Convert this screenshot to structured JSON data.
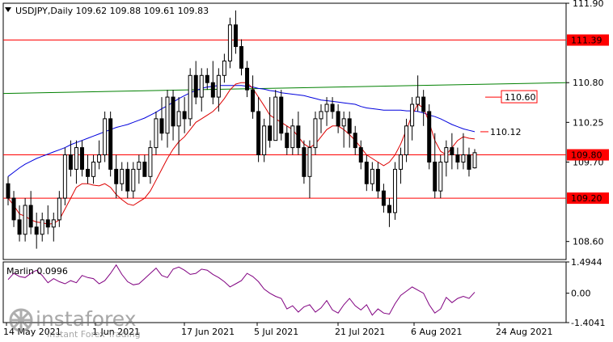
{
  "title": {
    "symbol_info": "USDJPY,Daily  109.62 109.88 109.61 109.83"
  },
  "chart_data": [
    {
      "type": "candlestick",
      "symbol": "USDJPY",
      "timeframe": "Daily",
      "ohlc_header": [
        109.62,
        109.88,
        109.61,
        109.83
      ],
      "ylim": [
        108.35,
        111.9
      ],
      "price_ticks": [
        "111.90",
        "110.80",
        "110.25",
        "109.70",
        "108.60"
      ],
      "x_tick_labels": [
        "14 May 2021",
        "1 Jun 2021",
        "17 Jun 2021",
        "5 Jul 2021",
        "21 Jul 2021",
        "6 Aug 2021",
        "24 Aug 2021"
      ],
      "candles": [
        [
          109.4,
          109.5,
          109.1,
          109.2
        ],
        [
          109.2,
          109.3,
          108.8,
          108.9
        ],
        [
          108.9,
          109.1,
          108.6,
          108.7
        ],
        [
          108.7,
          109.2,
          108.6,
          109.1
        ],
        [
          109.1,
          109.3,
          108.7,
          108.8
        ],
        [
          108.8,
          109.0,
          108.5,
          108.7
        ],
        [
          108.7,
          109.0,
          108.6,
          108.9
        ],
        [
          108.9,
          109.1,
          108.7,
          108.8
        ],
        [
          108.8,
          109.0,
          108.6,
          108.9
        ],
        [
          108.9,
          109.3,
          108.8,
          109.2
        ],
        [
          109.2,
          109.9,
          109.1,
          109.8
        ],
        [
          109.8,
          110.0,
          109.5,
          109.6
        ],
        [
          109.6,
          110.0,
          109.4,
          109.9
        ],
        [
          109.9,
          110.0,
          109.5,
          109.6
        ],
        [
          109.6,
          109.8,
          109.4,
          109.5
        ],
        [
          109.5,
          109.8,
          109.4,
          109.7
        ],
        [
          109.7,
          110.0,
          109.6,
          109.8
        ],
        [
          109.8,
          110.4,
          109.7,
          110.3
        ],
        [
          110.3,
          110.4,
          109.5,
          109.6
        ],
        [
          109.6,
          109.8,
          109.2,
          109.4
        ],
        [
          109.4,
          109.7,
          109.3,
          109.6
        ],
        [
          109.6,
          109.7,
          109.2,
          109.3
        ],
        [
          109.3,
          109.7,
          109.2,
          109.6
        ],
        [
          109.6,
          109.8,
          109.4,
          109.7
        ],
        [
          109.7,
          109.8,
          109.5,
          109.5
        ],
        [
          109.5,
          110.0,
          109.4,
          109.9
        ],
        [
          109.9,
          110.4,
          109.8,
          110.3
        ],
        [
          110.3,
          110.6,
          110.0,
          110.1
        ],
        [
          110.1,
          110.7,
          109.9,
          110.6
        ],
        [
          110.6,
          110.7,
          110.0,
          110.2
        ],
        [
          110.2,
          110.6,
          109.8,
          110.4
        ],
        [
          110.4,
          110.6,
          110.1,
          110.3
        ],
        [
          110.3,
          111.0,
          110.2,
          110.9
        ],
        [
          110.9,
          111.1,
          110.5,
          110.6
        ],
        [
          110.6,
          111.0,
          110.4,
          110.9
        ],
        [
          110.9,
          111.0,
          110.7,
          110.8
        ],
        [
          110.8,
          111.1,
          110.5,
          110.6
        ],
        [
          110.6,
          111.0,
          110.4,
          110.9
        ],
        [
          110.9,
          111.2,
          110.8,
          111.1
        ],
        [
          111.1,
          111.7,
          111.0,
          111.6
        ],
        [
          111.6,
          111.8,
          111.2,
          111.3
        ],
        [
          111.3,
          111.4,
          110.9,
          111.0
        ],
        [
          111.0,
          111.1,
          110.6,
          110.7
        ],
        [
          110.7,
          110.9,
          110.3,
          110.4
        ],
        [
          110.4,
          110.6,
          109.7,
          109.8
        ],
        [
          109.8,
          110.3,
          109.7,
          110.2
        ],
        [
          110.2,
          110.6,
          109.9,
          110.0
        ],
        [
          110.0,
          110.7,
          110.0,
          110.6
        ],
        [
          110.6,
          110.7,
          110.0,
          110.1
        ],
        [
          110.1,
          110.2,
          109.8,
          109.9
        ],
        [
          109.9,
          110.3,
          109.8,
          110.2
        ],
        [
          110.2,
          110.4,
          109.8,
          109.9
        ],
        [
          109.9,
          110.0,
          109.4,
          109.5
        ],
        [
          109.5,
          110.0,
          109.2,
          109.9
        ],
        [
          109.9,
          110.4,
          109.8,
          110.3
        ],
        [
          110.3,
          110.5,
          110.1,
          110.4
        ],
        [
          110.4,
          110.6,
          110.2,
          110.5
        ],
        [
          110.5,
          110.6,
          110.3,
          110.4
        ],
        [
          110.4,
          110.5,
          110.1,
          110.2
        ],
        [
          110.2,
          110.4,
          109.9,
          110.3
        ],
        [
          110.3,
          110.4,
          109.9,
          110.1
        ],
        [
          110.1,
          110.2,
          109.8,
          109.9
        ],
        [
          109.9,
          110.0,
          109.6,
          109.7
        ],
        [
          109.7,
          109.8,
          109.3,
          109.4
        ],
        [
          109.4,
          109.7,
          109.3,
          109.6
        ],
        [
          109.6,
          109.7,
          109.2,
          109.3
        ],
        [
          109.3,
          109.4,
          109.0,
          109.1
        ],
        [
          109.1,
          109.2,
          108.8,
          109.0
        ],
        [
          109.0,
          109.7,
          108.9,
          109.6
        ],
        [
          109.6,
          109.9,
          109.4,
          109.8
        ],
        [
          109.8,
          110.3,
          109.7,
          110.2
        ],
        [
          110.2,
          110.6,
          110.0,
          110.5
        ],
        [
          110.5,
          110.9,
          110.4,
          110.6
        ],
        [
          110.6,
          110.7,
          110.2,
          110.4
        ],
        [
          110.4,
          110.5,
          109.6,
          109.7
        ],
        [
          109.7,
          110.1,
          109.2,
          109.3
        ],
        [
          109.3,
          109.8,
          109.2,
          109.7
        ],
        [
          109.7,
          110.0,
          109.5,
          109.9
        ],
        [
          109.9,
          110.1,
          109.6,
          109.8
        ],
        [
          109.8,
          109.9,
          109.6,
          109.7
        ],
        [
          109.7,
          110.1,
          109.6,
          109.8
        ],
        [
          109.8,
          109.9,
          109.5,
          109.6
        ],
        [
          109.62,
          109.88,
          109.61,
          109.83
        ]
      ],
      "blue_ma": [
        109.5,
        109.56,
        109.62,
        109.67,
        109.71,
        109.75,
        109.78,
        109.81,
        109.84,
        109.87,
        109.9,
        109.94,
        109.97,
        110.0,
        110.03,
        110.06,
        110.09,
        110.12,
        110.15,
        110.18,
        110.2,
        110.22,
        110.25,
        110.28,
        110.31,
        110.35,
        110.39,
        110.44,
        110.48,
        110.53,
        110.58,
        110.62,
        110.66,
        110.69,
        110.72,
        110.74,
        110.75,
        110.76,
        110.76,
        110.76,
        110.76,
        110.76,
        110.75,
        110.74,
        110.72,
        110.71,
        110.69,
        110.68,
        110.66,
        110.65,
        110.64,
        110.63,
        110.62,
        110.6,
        110.58,
        110.56,
        110.55,
        110.54,
        110.53,
        110.52,
        110.51,
        110.5,
        110.47,
        110.45,
        110.44,
        110.43,
        110.42,
        110.42,
        110.42,
        110.42,
        110.41,
        110.41,
        110.4,
        110.38,
        110.35,
        110.33,
        110.3,
        110.26,
        110.22,
        110.19,
        110.16,
        110.14,
        110.12
      ],
      "red_ma": [
        109.2,
        109.1,
        108.98,
        108.95,
        108.9,
        108.87,
        108.86,
        108.84,
        108.85,
        108.9,
        109.05,
        109.2,
        109.35,
        109.4,
        109.4,
        109.38,
        109.37,
        109.4,
        109.35,
        109.25,
        109.18,
        109.12,
        109.1,
        109.15,
        109.2,
        109.3,
        109.45,
        109.6,
        109.75,
        109.88,
        109.98,
        110.05,
        110.15,
        110.25,
        110.3,
        110.35,
        110.4,
        110.48,
        110.58,
        110.7,
        110.78,
        110.8,
        110.8,
        110.72,
        110.6,
        110.48,
        110.35,
        110.3,
        110.25,
        110.2,
        110.15,
        110.05,
        109.95,
        109.9,
        109.95,
        110.05,
        110.15,
        110.2,
        110.2,
        110.15,
        110.08,
        110.0,
        109.9,
        109.8,
        109.75,
        109.7,
        109.65,
        109.7,
        109.8,
        109.95,
        110.15,
        110.35,
        110.5,
        110.45,
        110.25,
        110.0,
        109.85,
        109.8,
        109.9,
        110.0,
        110.05,
        110.03,
        110.02
      ],
      "green_line": {
        "start": 110.65,
        "end": 110.8
      },
      "horizontal_levels": [
        {
          "price": 111.39,
          "label": "111.39",
          "color": "#ff0000"
        },
        {
          "price": 109.8,
          "label": "109.80",
          "color": "#ff0000"
        },
        {
          "price": 109.2,
          "label": "109.20",
          "color": "#ff0000"
        }
      ],
      "annotations": [
        {
          "price": 110.6,
          "label": "110.60",
          "color": "#ff0000"
        },
        {
          "price": 110.12,
          "label": "110.12",
          "color": "#ff0000"
        }
      ],
      "colors": {
        "bull_candle": "#ffffff",
        "bear_candle": "#000000",
        "blue_ma": "#0000dd",
        "red_ma": "#dd0000",
        "green_line": "#008000",
        "indicator_line": "#800080"
      }
    },
    {
      "type": "line",
      "name": "Marlin 0.0996",
      "ylim": [
        -1.4041,
        1.4944
      ],
      "y_ticks": [
        "1.4944",
        "0.00",
        "-1.4041"
      ],
      "values": [
        0.65,
        0.95,
        0.8,
        0.75,
        0.95,
        1.1,
        0.85,
        0.5,
        0.7,
        0.55,
        0.45,
        0.6,
        0.5,
        0.85,
        0.75,
        0.7,
        0.45,
        0.6,
        0.95,
        1.35,
        0.9,
        0.55,
        0.4,
        0.45,
        0.7,
        0.95,
        1.2,
        0.85,
        0.75,
        1.15,
        1.25,
        1.1,
        0.9,
        0.95,
        1.15,
        1.1,
        0.9,
        0.75,
        0.55,
        0.3,
        0.45,
        0.6,
        0.95,
        0.8,
        0.55,
        0.2,
        0.0,
        -0.15,
        -0.25,
        -0.75,
        -0.6,
        -0.9,
        -0.65,
        -0.55,
        -0.9,
        -0.7,
        -0.35,
        -0.8,
        -0.95,
        -0.55,
        -0.25,
        -0.6,
        -0.8,
        -0.55,
        -1.05,
        -0.75,
        -0.95,
        -1.0,
        -0.5,
        -0.1,
        0.1,
        0.3,
        0.15,
        0.0,
        -0.55,
        -0.95,
        -0.75,
        -0.2,
        -0.45,
        -0.25,
        -0.15,
        -0.25,
        0.05
      ]
    }
  ],
  "watermark": {
    "brand": "instaforex",
    "tagline": "Instant Forex Trading"
  }
}
